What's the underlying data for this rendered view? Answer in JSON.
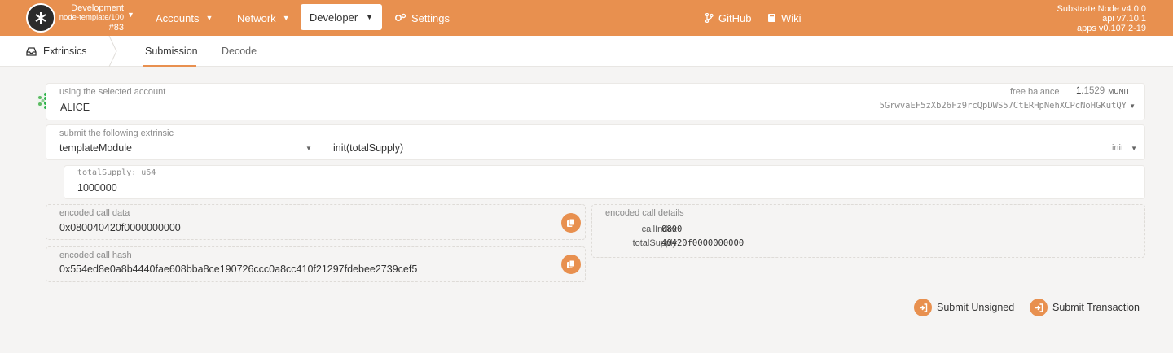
{
  "topbar": {
    "chain_name": "Development",
    "chain_node": "node-template/100",
    "block": "#83",
    "nav": {
      "accounts": "Accounts",
      "network": "Network",
      "developer": "Developer",
      "settings": "Settings",
      "github": "GitHub",
      "wiki": "Wiki"
    },
    "version": {
      "node": "Substrate Node v4.0.0",
      "api": "api v7.10.1",
      "apps": "apps v0.107.2-19"
    },
    "accent_color": "#e8904f"
  },
  "subnav": {
    "section": "Extrinsics",
    "tabs": [
      "Submission",
      "Decode"
    ],
    "active_tab": "Submission"
  },
  "account": {
    "label": "using the selected account",
    "name": "ALICE",
    "free_balance_label": "free balance",
    "balance_int": "1.",
    "balance_frac": "1529",
    "unit": "MUNIT",
    "address": "5GrwvaEF5zXb26Fz9rcQpDWS57CtERHpNehXCPcNoHGKutQY"
  },
  "extrinsic": {
    "label": "submit the following extrinsic",
    "module": "templateModule",
    "call": "init(totalSupply)",
    "method": "init"
  },
  "param": {
    "label": "totalSupply: u64",
    "value": "1000000"
  },
  "encoded": {
    "data_label": "encoded call data",
    "data": "0x080040420f0000000000",
    "hash_label": "encoded call hash",
    "hash": "0x554ed8e0a8b4440fae608bba8ce190726ccc0a8cc410f21297fdebee2739cef5",
    "details_label": "encoded call details",
    "call_index_label": "callIndex",
    "call_index": "0800",
    "total_supply_label": "totalSupply",
    "total_supply": "40420f0000000000"
  },
  "actions": {
    "submit_unsigned": "Submit Unsigned",
    "submit_transaction": "Submit Transaction"
  }
}
